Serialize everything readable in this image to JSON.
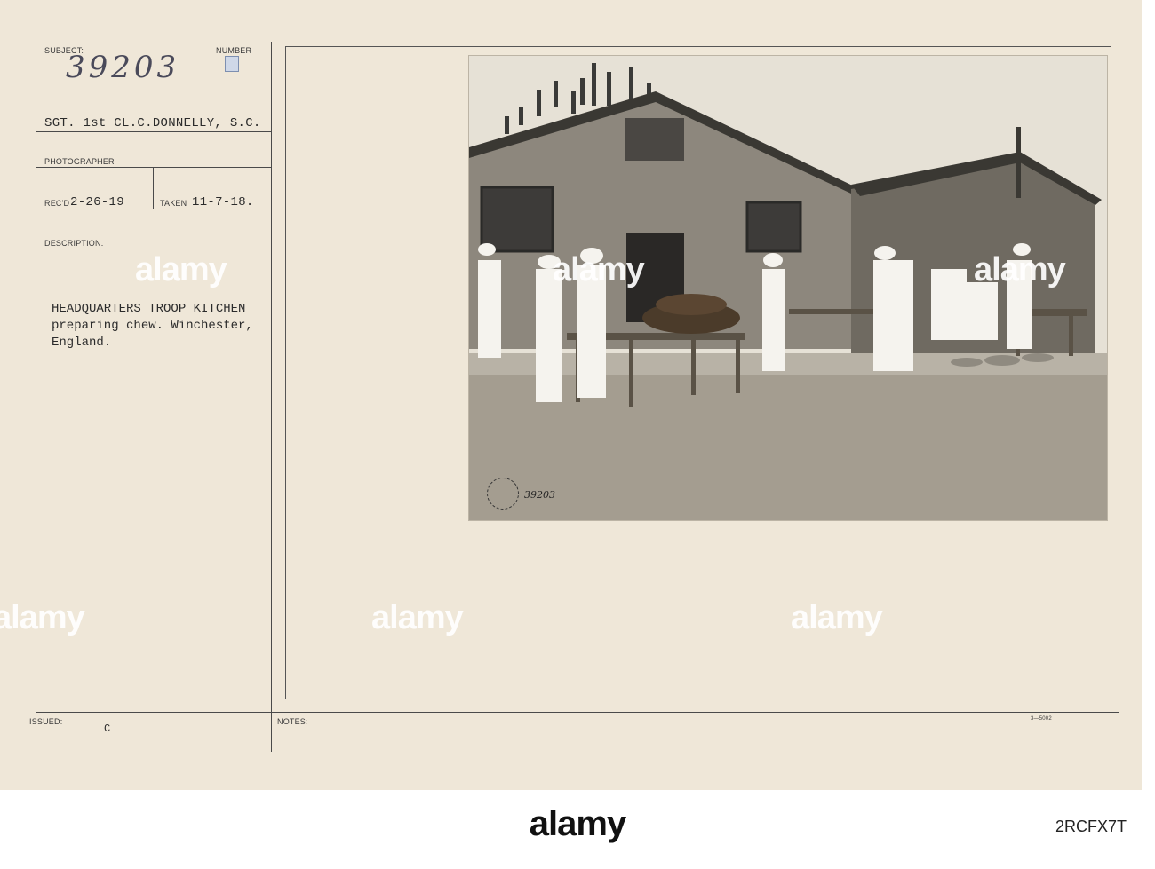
{
  "card": {
    "subject_label": "SUBJECT:",
    "number_label": "NUMBER",
    "number_value": "39203",
    "photographer_value": "SGT. 1st CL.C.DONNELLY, S.C.",
    "photographer_label": "PHOTOGRAPHER",
    "recd_label": "REC'D",
    "recd_value": "2-26-19",
    "taken_label": "TAKEN",
    "taken_value": "11-7-18.",
    "description_label": "DESCRIPTION.",
    "description_text": "HEADQUARTERS TROOP KITCHEN\npreparing chew. Winchester,\nEngland.",
    "issued_label": "ISSUED:",
    "issued_value": "C",
    "notes_label": "NOTES:",
    "form_number": "3—5002"
  },
  "photo": {
    "stamp_text": "SIGNAL CORPS USA",
    "photo_number": "39203"
  },
  "watermark": {
    "brand": "alamy",
    "image_id": "2RCFX7T"
  },
  "colors": {
    "card": "#efe7d8",
    "ink": "#2b2b2b",
    "footer": "#ffffff"
  }
}
